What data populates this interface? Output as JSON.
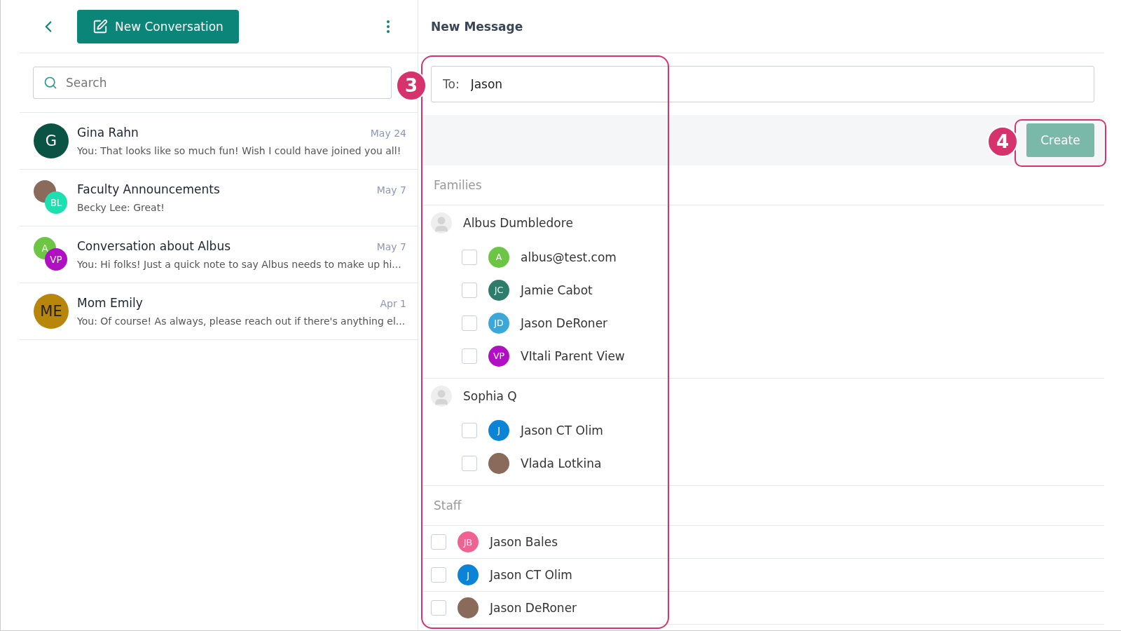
{
  "sidebar": {
    "new_button": "New Conversation",
    "search": {
      "placeholder": "Search"
    },
    "conversations": [
      {
        "title": "Gina Rahn",
        "date": "May 24",
        "preview": "You:  That looks like so much fun! Wish I could have joined you all!",
        "avatar": {
          "kind": "letter",
          "initials": "G",
          "color": "#0b5345"
        }
      },
      {
        "title": "Faculty Announcements",
        "date": "May 7",
        "preview": "Becky Lee:  Great!",
        "avatar": {
          "kind": "stack",
          "back": {
            "kind": "photo"
          },
          "front": {
            "kind": "letter",
            "initials": "BL",
            "color": "#1de0b0"
          }
        }
      },
      {
        "title": "Conversation about Albus",
        "date": "May 7",
        "preview": "You:  Hi folks! Just a quick note to say Albus needs to make up hi...",
        "avatar": {
          "kind": "stack",
          "back": {
            "kind": "letter",
            "initials": "A",
            "color": "#6cc644"
          },
          "front": {
            "kind": "letter",
            "initials": "VP",
            "color": "#b00fc4"
          }
        }
      },
      {
        "title": "Mom Emily",
        "date": "Apr 1",
        "preview": "You:  Of course! As always, please reach out if there's anything el...",
        "avatar": {
          "kind": "letter",
          "initials": "ME",
          "color": "#b8860b"
        }
      }
    ]
  },
  "main": {
    "title": "New Message",
    "to_label": "To:",
    "to_value": "Jason",
    "create_button": "Create",
    "sections": [
      {
        "label": "Families",
        "groups": [
          {
            "name": "Albus Dumbledore",
            "contacts": [
              {
                "name": "albus@test.com",
                "checked": false,
                "avatar": {
                  "kind": "letter",
                  "initials": "A",
                  "color": "#6cc644"
                }
              },
              {
                "name": "Jamie Cabot",
                "checked": false,
                "avatar": {
                  "kind": "letter",
                  "initials": "JC",
                  "color": "#2e7d6b"
                }
              },
              {
                "name": "Jason DeRoner",
                "checked": false,
                "avatar": {
                  "kind": "letter",
                  "initials": "JD",
                  "color": "#3aa8d8"
                }
              },
              {
                "name": "VItali Parent View",
                "checked": false,
                "avatar": {
                  "kind": "letter",
                  "initials": "VP",
                  "color": "#b00fc4"
                }
              }
            ]
          },
          {
            "name": "Sophia Q",
            "contacts": [
              {
                "name": "Jason CT Olim",
                "checked": false,
                "avatar": {
                  "kind": "letter",
                  "initials": "J",
                  "color": "#0b84d8"
                }
              },
              {
                "name": "Vlada Lotkina",
                "checked": false,
                "avatar": {
                  "kind": "photo"
                }
              }
            ]
          }
        ]
      },
      {
        "label": "Staff",
        "contacts": [
          {
            "name": "Jason Bales",
            "checked": false,
            "avatar": {
              "kind": "letter",
              "initials": "JB",
              "color": "#f06292"
            }
          },
          {
            "name": "Jason CT Olim",
            "checked": false,
            "avatar": {
              "kind": "letter",
              "initials": "J",
              "color": "#0b84d8"
            }
          },
          {
            "name": "Jason DeRoner",
            "checked": false,
            "avatar": {
              "kind": "photo"
            }
          }
        ]
      }
    ]
  },
  "annotations": [
    {
      "label": "3"
    },
    {
      "label": "4"
    }
  ]
}
